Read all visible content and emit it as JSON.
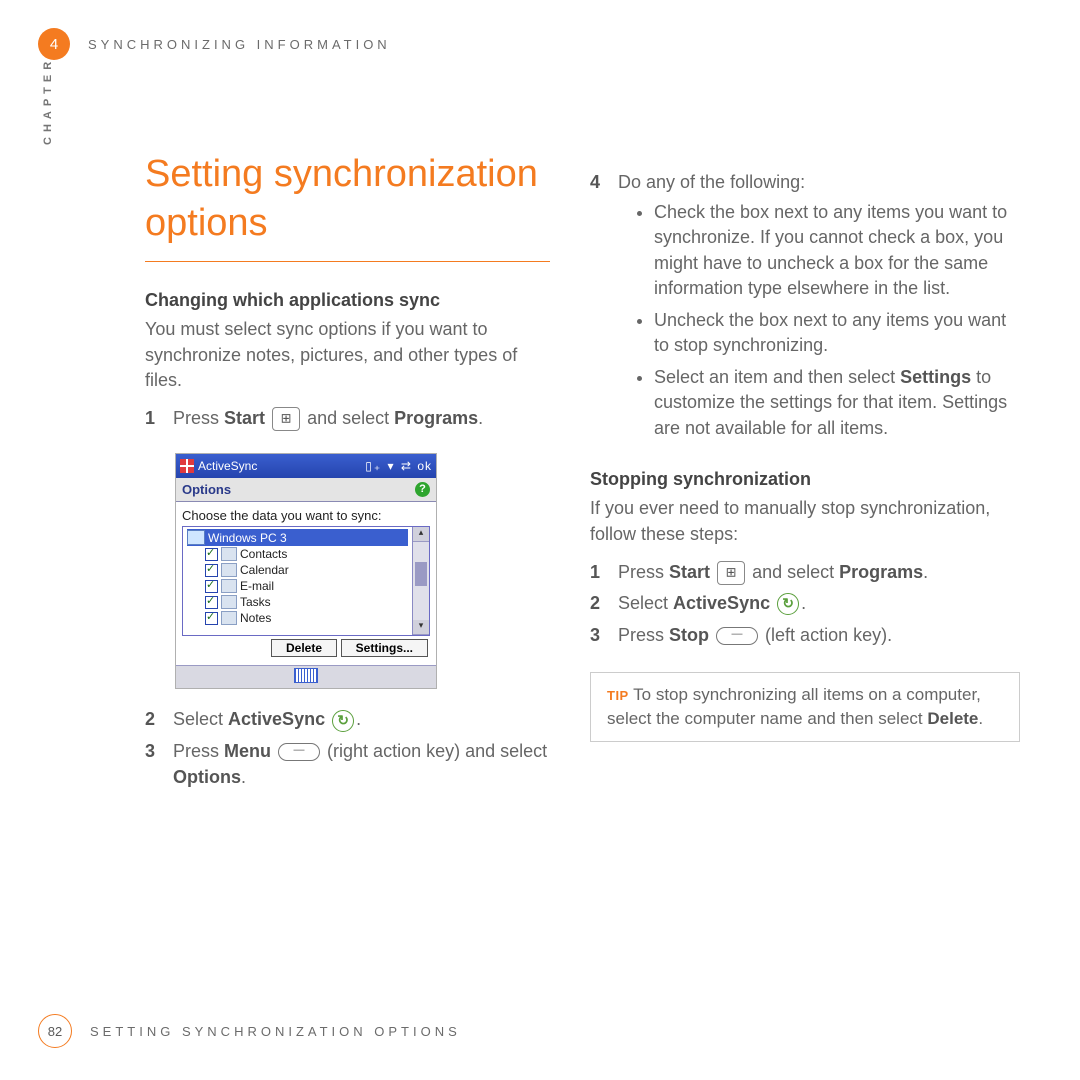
{
  "header": {
    "chapter_num": "4",
    "running_head": "SYNCHRONIZING INFORMATION"
  },
  "side_label": "CHAPTER",
  "title": "Setting synchronization options",
  "left": {
    "subhead": "Changing which applications sync",
    "intro": "You must select sync options if you want to synchronize notes, pictures, and other types of files.",
    "step1_a": "Press ",
    "step1_b": "Start",
    "step1_c": " and select ",
    "step1_d": "Programs",
    "step1_e": ".",
    "step2_a": "Select ",
    "step2_b": "ActiveSync",
    "step2_c": ".",
    "step3_a": "Press ",
    "step3_b": "Menu",
    "step3_c": " (right action key) and select ",
    "step3_d": "Options",
    "step3_e": "."
  },
  "screenshot": {
    "title": "ActiveSync",
    "status_right": "ok",
    "options_label": "Options",
    "prompt": "Choose the data you want to sync:",
    "items": [
      {
        "label": "Windows PC 3",
        "checked": false,
        "root": true
      },
      {
        "label": "Contacts",
        "checked": true
      },
      {
        "label": "Calendar",
        "checked": true
      },
      {
        "label": "E-mail",
        "checked": true
      },
      {
        "label": "Tasks",
        "checked": true
      },
      {
        "label": "Notes",
        "checked": true
      }
    ],
    "btn_delete": "Delete",
    "btn_settings": "Settings..."
  },
  "right": {
    "step4_intro": "Do any of the following:",
    "bullet1": "Check the box next to any items you want to synchronize. If you cannot check a box, you might have to uncheck a box for the same information type elsewhere in the list.",
    "bullet2": "Uncheck the box next to any items you want to stop synchronizing.",
    "bullet3_a": "Select an item and then select ",
    "bullet3_b": "Settings",
    "bullet3_c": " to customize the settings for that item. Settings are not available for all items.",
    "subhead2": "Stopping synchronization",
    "intro2": "If you ever need to manually stop synchronization, follow these steps:",
    "s1_a": "Press ",
    "s1_b": "Start",
    "s1_c": " and select ",
    "s1_d": "Programs",
    "s1_e": ".",
    "s2_a": "Select ",
    "s2_b": "ActiveSync",
    "s2_c": ".",
    "s3_a": "Press ",
    "s3_b": "Stop",
    "s3_c": " (left action key).",
    "tip_label": "TIP",
    "tip_a": "To stop synchronizing all items on a computer, select the computer name and then select ",
    "tip_b": "Delete",
    "tip_c": "."
  },
  "footer": {
    "page_num": "82",
    "running_foot": "SETTING SYNCHRONIZATION OPTIONS"
  }
}
